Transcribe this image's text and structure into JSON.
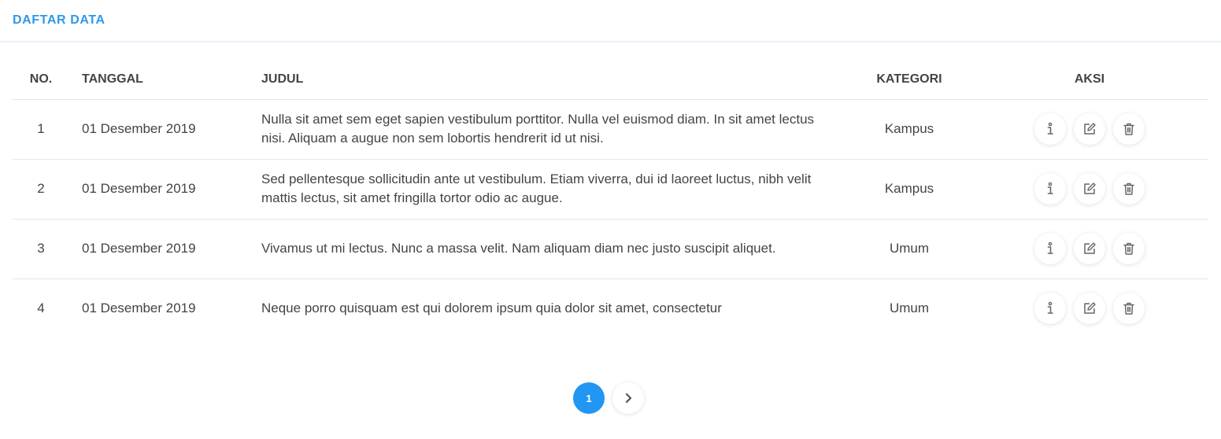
{
  "header": {
    "title": "DAFTAR DATA"
  },
  "table": {
    "columns": {
      "no": "NO.",
      "date": "TANGGAL",
      "title": "JUDUL",
      "category": "KATEGORI",
      "actions": "AKSI"
    },
    "rows": [
      {
        "no": "1",
        "date": "01 Desember 2019",
        "title": "Nulla sit amet sem eget sapien vestibulum porttitor. Nulla vel euismod diam. In sit amet lectus nisi. Aliquam a augue non sem lobortis hendrerit id ut nisi.",
        "category": "Kampus"
      },
      {
        "no": "2",
        "date": "01 Desember 2019",
        "title": "Sed pellentesque sollicitudin ante ut vestibulum. Etiam viverra, dui id laoreet luctus, nibh velit mattis lectus, sit amet fringilla tortor odio ac augue.",
        "category": "Kampus"
      },
      {
        "no": "3",
        "date": "01 Desember 2019",
        "title": "Vivamus ut mi lectus. Nunc a massa velit. Nam aliquam diam nec justo suscipit aliquet.",
        "category": "Umum"
      },
      {
        "no": "4",
        "date": "01 Desember 2019",
        "title": "Neque porro quisquam est qui dolorem ipsum quia dolor sit amet, consectetur",
        "category": "Umum"
      }
    ],
    "row_actions": [
      "info-icon",
      "edit-icon",
      "trash-icon"
    ]
  },
  "pagination": {
    "current_page": "1",
    "next_icon": "chevron-right-icon"
  },
  "colors": {
    "accent": "#2f98ea",
    "page_active": "#2196f3",
    "icon": "#666666"
  }
}
